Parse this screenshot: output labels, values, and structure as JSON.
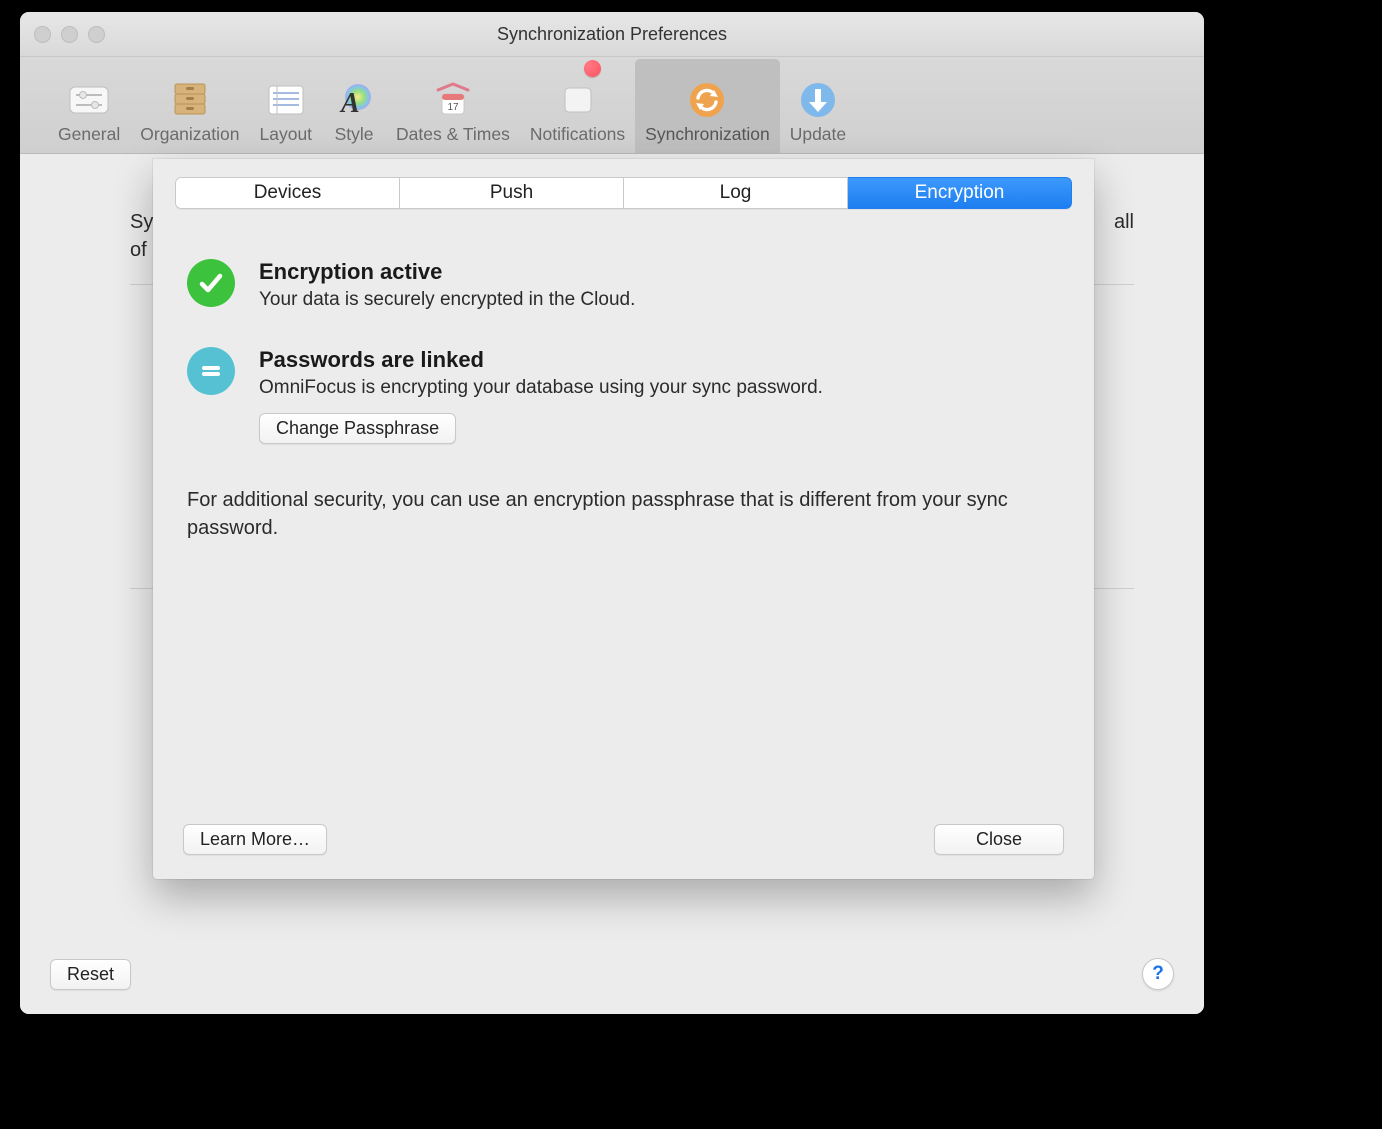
{
  "window": {
    "title": "Synchronization Preferences"
  },
  "toolbar": {
    "general": "General",
    "organization": "Organization",
    "layout": "Layout",
    "style": "Style",
    "dates_times": "Dates & Times",
    "notifications": "Notifications",
    "synchronization": "Synchronization",
    "update": "Update"
  },
  "background": {
    "line1_prefix": "Sy",
    "line2_prefix": "of",
    "line1_suffix": "all"
  },
  "sheet": {
    "tabs": {
      "devices": "Devices",
      "push": "Push",
      "log": "Log",
      "encryption": "Encryption"
    },
    "encryption_active": {
      "title": "Encryption active",
      "subtitle": "Your data is securely encrypted in the Cloud."
    },
    "passwords_linked": {
      "title": "Passwords are linked",
      "subtitle": "OmniFocus is encrypting your database using your sync password.",
      "change_button": "Change Passphrase"
    },
    "hint": "For additional security, you can use an encryption passphrase that is different from your sync password.",
    "learn_more": "Learn More…",
    "close": "Close"
  },
  "footer": {
    "reset": "Reset",
    "help_glyph": "?"
  }
}
